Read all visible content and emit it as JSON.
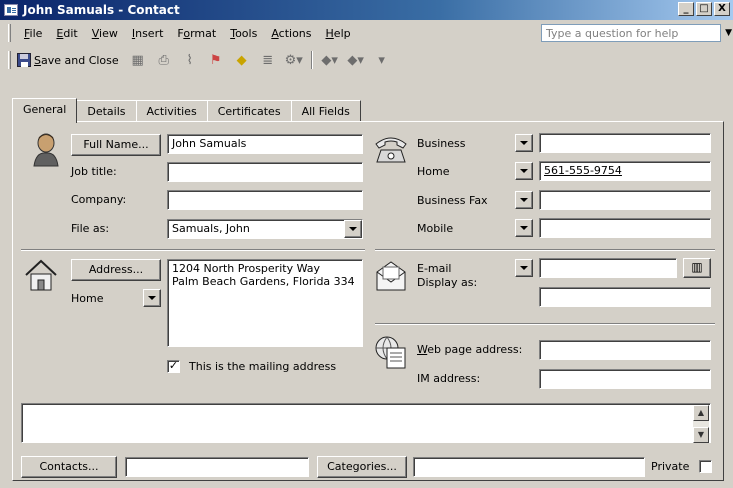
{
  "window": {
    "title": "John Samuals - Contact",
    "controls": {
      "minimize": "_",
      "maximize": "□",
      "close": "X"
    }
  },
  "menu": {
    "items": [
      "File",
      "Edit",
      "View",
      "Insert",
      "Format",
      "Tools",
      "Actions",
      "Help"
    ],
    "help_placeholder": "Type a question for help"
  },
  "toolbar": {
    "save_close_label": "Save and Close",
    "icons": [
      "contact-card-icon",
      "print-icon",
      "paperclip-icon",
      "flag-icon",
      "categories-icon",
      "details-icon",
      "actions-icon",
      "previous-item-icon",
      "next-item-icon"
    ]
  },
  "tabs": [
    "General",
    "Details",
    "Activities",
    "Certificates",
    "All Fields"
  ],
  "active_tab": "General",
  "left": {
    "full_name_btn": "Full Name...",
    "full_name": "John Samuals",
    "job_title_label": "Job title:",
    "job_title": "",
    "company_label": "Company:",
    "company": "",
    "file_as_label": "File as:",
    "file_as": "Samuals, John",
    "address_btn": "Address...",
    "address_type": "Home",
    "address_line1": "1204 North Prosperity Way",
    "address_line2": "Palm Beach Gardens, Florida  334",
    "mailing_label": "This is the mailing address",
    "mailing_checked": "✓"
  },
  "right": {
    "phones": [
      {
        "label": "Business",
        "value": ""
      },
      {
        "label": "Home",
        "value": "561-555-9754"
      },
      {
        "label": "Business Fax",
        "value": ""
      },
      {
        "label": "Mobile",
        "value": ""
      }
    ],
    "email_label": "E-mail",
    "email": "",
    "display_as_label": "Display as:",
    "display_as": "",
    "web_label": "Web page address:",
    "web": "",
    "im_label": "IM address:",
    "im": ""
  },
  "bottom": {
    "contacts_btn": "Contacts...",
    "contacts": "",
    "categories_btn": "Categories...",
    "categories": "",
    "private_label": "Private"
  }
}
